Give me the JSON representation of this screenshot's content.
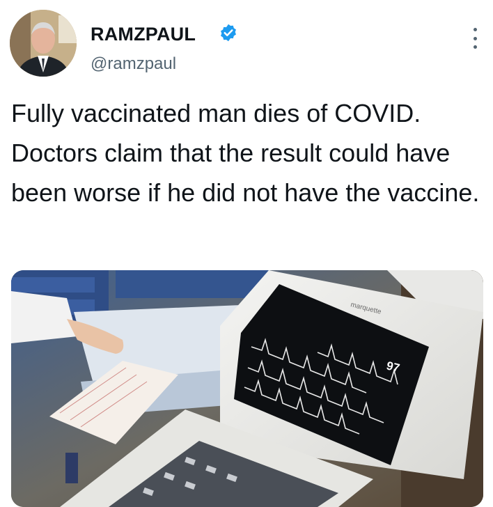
{
  "tweet": {
    "author": {
      "display_name": "RAMZPAUL",
      "handle": "@ramzpaul",
      "verified": true,
      "avatar_icon": "profile-photo"
    },
    "more_icon": "more-options-icon",
    "text": "Fully vaccinated man dies of COVID. Doctors claim that the result could have been worse if he did not have the vaccine.",
    "media": {
      "type": "photo",
      "monitor": {
        "brand": "marquette",
        "reading": "97"
      }
    }
  },
  "colors": {
    "verified_badge": "#1d9bf0",
    "handle": "#536471",
    "text": "#0f1419"
  }
}
